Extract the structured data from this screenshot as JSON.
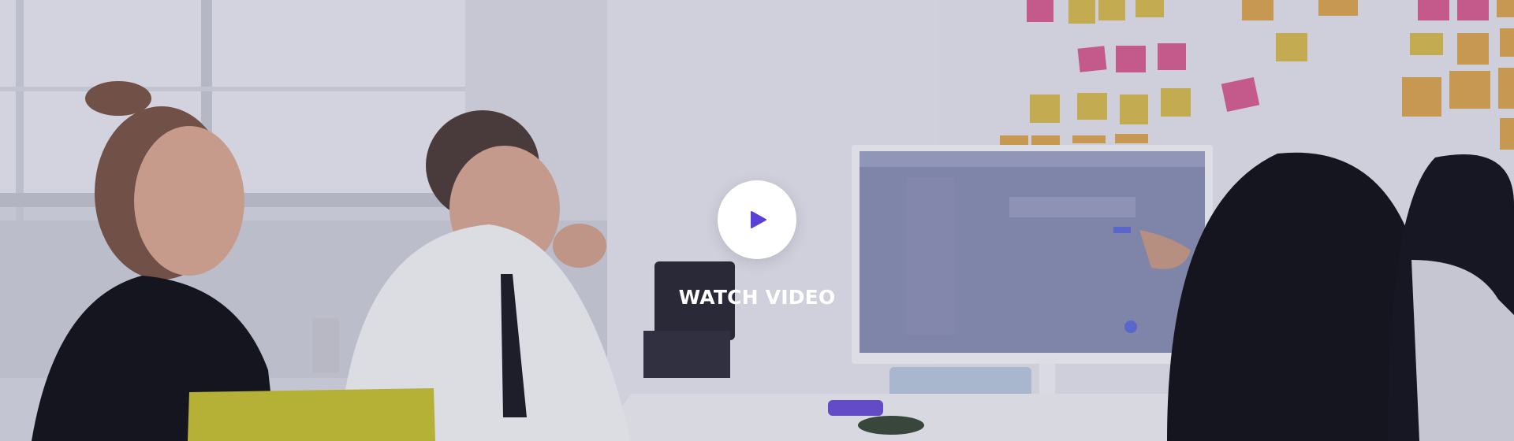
{
  "hero": {
    "cta_label": "WATCH VIDEO",
    "accent_color": "#5a3fd8",
    "play_icon": "play-icon"
  }
}
